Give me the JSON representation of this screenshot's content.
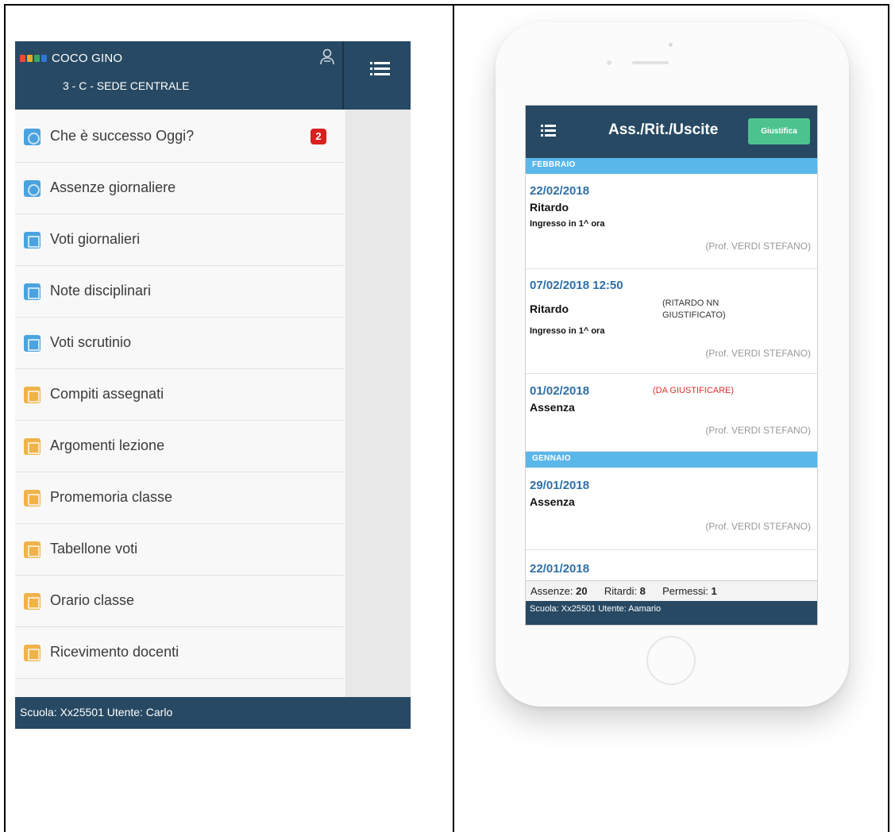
{
  "left_panel": {
    "header": {
      "user_name": "COCO GINO",
      "class_info": "3 - C - SEDE CENTRALE",
      "logo_colors": [
        "#e94b35",
        "#f5a623",
        "#3aa757",
        "#2f78d2"
      ]
    },
    "menu": [
      {
        "label": "Che è successo Oggi?",
        "icon": "clock-icon",
        "color": "#4aa3df",
        "badge": "2"
      },
      {
        "label": "Assenze giornaliere",
        "icon": "clock-icon",
        "color": "#4aa3df"
      },
      {
        "label": "Voti giornalieri",
        "icon": "grades-icon",
        "color": "#4aa3df"
      },
      {
        "label": "Note disciplinari",
        "icon": "notes-icon",
        "color": "#4aa3df"
      },
      {
        "label": "Voti scrutinio",
        "icon": "report-icon",
        "color": "#4aa3df"
      },
      {
        "label": "Compiti assegnati",
        "icon": "homework-icon",
        "color": "#f0b24a"
      },
      {
        "label": "Argomenti lezione",
        "icon": "topics-icon",
        "color": "#f0b24a"
      },
      {
        "label": "Promemoria classe",
        "icon": "reminder-icon",
        "color": "#f0b24a"
      },
      {
        "label": "Tabellone voti",
        "icon": "board-icon",
        "color": "#f0b24a"
      },
      {
        "label": "Orario classe",
        "icon": "timetable-icon",
        "color": "#f0b24a"
      },
      {
        "label": "Ricevimento docenti",
        "icon": "meeting-icon",
        "color": "#f0b24a"
      }
    ],
    "footer": "Scuola: Xx25501 Utente: Carlo"
  },
  "right_panel": {
    "app": {
      "title": "Ass./Rit./Uscite",
      "justify_button": "Giustifica"
    },
    "months": [
      {
        "name": "FEBBRAIO"
      },
      {
        "name": "GENNAIO"
      }
    ],
    "entries": [
      {
        "date": "22/02/2018",
        "type": "Ritardo",
        "detail": "Ingresso in 1^ ora",
        "prof": "(Prof. VERDI STEFANO)"
      },
      {
        "date": "07/02/2018 12:50",
        "type": "Ritardo",
        "note": "(RITARDO NN GIUSTIFICATO)",
        "detail": "Ingresso in 1^ ora",
        "prof": "(Prof. VERDI STEFANO)"
      },
      {
        "date": "01/02/2018",
        "type": "Assenza",
        "status": "(DA GIUSTIFICARE)",
        "prof": "(Prof. VERDI STEFANO)"
      },
      {
        "date": "29/01/2018",
        "type": "Assenza",
        "prof": "(Prof. VERDI STEFANO)"
      },
      {
        "date": "22/01/2018"
      }
    ],
    "summary": {
      "absences_label": "Assenze:",
      "absences_value": "20",
      "delays_label": "Ritardi:",
      "delays_value": "8",
      "permits_label": "Permessi:",
      "permits_value": "1"
    },
    "footer": "Scuola: Xx25501 Utente: Aamario"
  }
}
